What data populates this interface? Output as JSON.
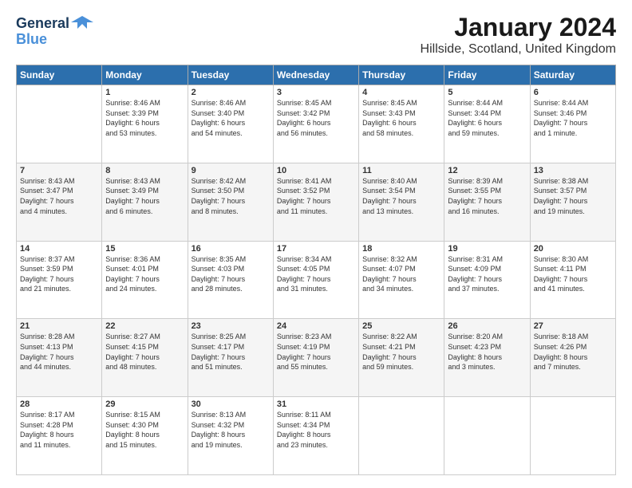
{
  "logo": {
    "line1": "General",
    "line2": "Blue"
  },
  "title": "January 2024",
  "location": "Hillside, Scotland, United Kingdom",
  "days_header": [
    "Sunday",
    "Monday",
    "Tuesday",
    "Wednesday",
    "Thursday",
    "Friday",
    "Saturday"
  ],
  "weeks": [
    {
      "cells": [
        {
          "num": "",
          "text": ""
        },
        {
          "num": "1",
          "text": "Sunrise: 8:46 AM\nSunset: 3:39 PM\nDaylight: 6 hours\nand 53 minutes."
        },
        {
          "num": "2",
          "text": "Sunrise: 8:46 AM\nSunset: 3:40 PM\nDaylight: 6 hours\nand 54 minutes."
        },
        {
          "num": "3",
          "text": "Sunrise: 8:45 AM\nSunset: 3:42 PM\nDaylight: 6 hours\nand 56 minutes."
        },
        {
          "num": "4",
          "text": "Sunrise: 8:45 AM\nSunset: 3:43 PM\nDaylight: 6 hours\nand 58 minutes."
        },
        {
          "num": "5",
          "text": "Sunrise: 8:44 AM\nSunset: 3:44 PM\nDaylight: 6 hours\nand 59 minutes."
        },
        {
          "num": "6",
          "text": "Sunrise: 8:44 AM\nSunset: 3:46 PM\nDaylight: 7 hours\nand 1 minute."
        }
      ]
    },
    {
      "cells": [
        {
          "num": "7",
          "text": "Sunrise: 8:43 AM\nSunset: 3:47 PM\nDaylight: 7 hours\nand 4 minutes."
        },
        {
          "num": "8",
          "text": "Sunrise: 8:43 AM\nSunset: 3:49 PM\nDaylight: 7 hours\nand 6 minutes."
        },
        {
          "num": "9",
          "text": "Sunrise: 8:42 AM\nSunset: 3:50 PM\nDaylight: 7 hours\nand 8 minutes."
        },
        {
          "num": "10",
          "text": "Sunrise: 8:41 AM\nSunset: 3:52 PM\nDaylight: 7 hours\nand 11 minutes."
        },
        {
          "num": "11",
          "text": "Sunrise: 8:40 AM\nSunset: 3:54 PM\nDaylight: 7 hours\nand 13 minutes."
        },
        {
          "num": "12",
          "text": "Sunrise: 8:39 AM\nSunset: 3:55 PM\nDaylight: 7 hours\nand 16 minutes."
        },
        {
          "num": "13",
          "text": "Sunrise: 8:38 AM\nSunset: 3:57 PM\nDaylight: 7 hours\nand 19 minutes."
        }
      ]
    },
    {
      "cells": [
        {
          "num": "14",
          "text": "Sunrise: 8:37 AM\nSunset: 3:59 PM\nDaylight: 7 hours\nand 21 minutes."
        },
        {
          "num": "15",
          "text": "Sunrise: 8:36 AM\nSunset: 4:01 PM\nDaylight: 7 hours\nand 24 minutes."
        },
        {
          "num": "16",
          "text": "Sunrise: 8:35 AM\nSunset: 4:03 PM\nDaylight: 7 hours\nand 28 minutes."
        },
        {
          "num": "17",
          "text": "Sunrise: 8:34 AM\nSunset: 4:05 PM\nDaylight: 7 hours\nand 31 minutes."
        },
        {
          "num": "18",
          "text": "Sunrise: 8:32 AM\nSunset: 4:07 PM\nDaylight: 7 hours\nand 34 minutes."
        },
        {
          "num": "19",
          "text": "Sunrise: 8:31 AM\nSunset: 4:09 PM\nDaylight: 7 hours\nand 37 minutes."
        },
        {
          "num": "20",
          "text": "Sunrise: 8:30 AM\nSunset: 4:11 PM\nDaylight: 7 hours\nand 41 minutes."
        }
      ]
    },
    {
      "cells": [
        {
          "num": "21",
          "text": "Sunrise: 8:28 AM\nSunset: 4:13 PM\nDaylight: 7 hours\nand 44 minutes."
        },
        {
          "num": "22",
          "text": "Sunrise: 8:27 AM\nSunset: 4:15 PM\nDaylight: 7 hours\nand 48 minutes."
        },
        {
          "num": "23",
          "text": "Sunrise: 8:25 AM\nSunset: 4:17 PM\nDaylight: 7 hours\nand 51 minutes."
        },
        {
          "num": "24",
          "text": "Sunrise: 8:23 AM\nSunset: 4:19 PM\nDaylight: 7 hours\nand 55 minutes."
        },
        {
          "num": "25",
          "text": "Sunrise: 8:22 AM\nSunset: 4:21 PM\nDaylight: 7 hours\nand 59 minutes."
        },
        {
          "num": "26",
          "text": "Sunrise: 8:20 AM\nSunset: 4:23 PM\nDaylight: 8 hours\nand 3 minutes."
        },
        {
          "num": "27",
          "text": "Sunrise: 8:18 AM\nSunset: 4:26 PM\nDaylight: 8 hours\nand 7 minutes."
        }
      ]
    },
    {
      "cells": [
        {
          "num": "28",
          "text": "Sunrise: 8:17 AM\nSunset: 4:28 PM\nDaylight: 8 hours\nand 11 minutes."
        },
        {
          "num": "29",
          "text": "Sunrise: 8:15 AM\nSunset: 4:30 PM\nDaylight: 8 hours\nand 15 minutes."
        },
        {
          "num": "30",
          "text": "Sunrise: 8:13 AM\nSunset: 4:32 PM\nDaylight: 8 hours\nand 19 minutes."
        },
        {
          "num": "31",
          "text": "Sunrise: 8:11 AM\nSunset: 4:34 PM\nDaylight: 8 hours\nand 23 minutes."
        },
        {
          "num": "",
          "text": ""
        },
        {
          "num": "",
          "text": ""
        },
        {
          "num": "",
          "text": ""
        }
      ]
    }
  ]
}
